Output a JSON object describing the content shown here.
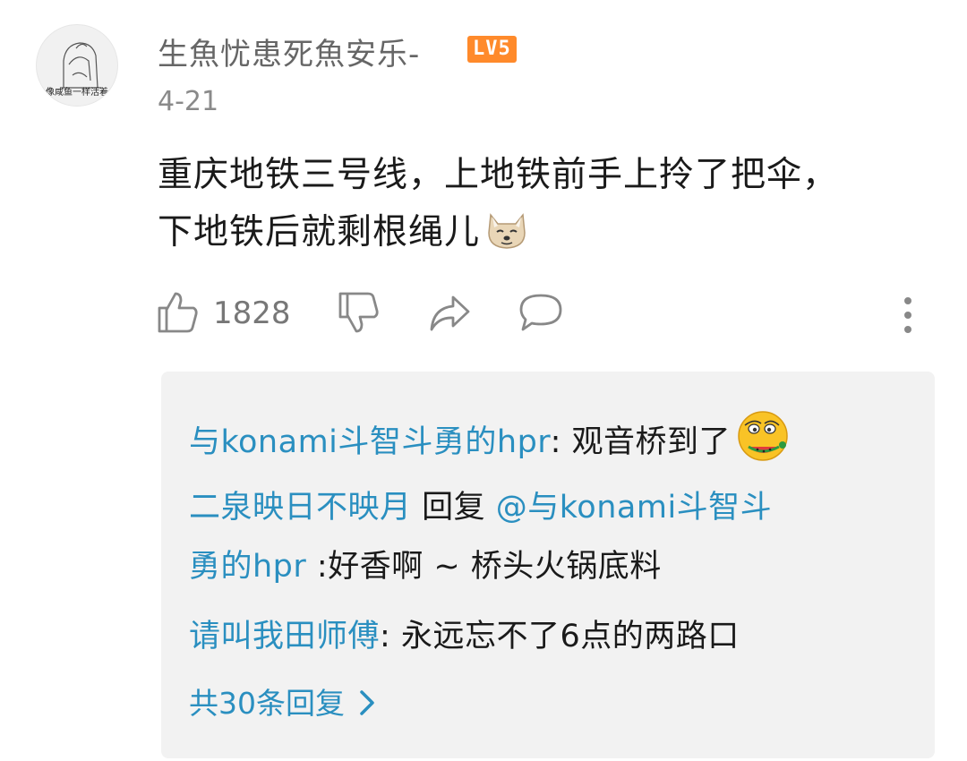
{
  "comment": {
    "avatar_caption": "像咸鱼一样活着",
    "username": "生魚忧患死魚安乐-",
    "level": "LV5",
    "date": "4-21",
    "text_line1": "重庆地铁三号线，上地铁前手上拎了把伞，",
    "text_line2": "下地铁后就剩根绳儿",
    "emoji": "doge-emoji",
    "like_count": "1828"
  },
  "actions": {
    "icons": [
      "thumbs-up-icon",
      "thumbs-down-icon",
      "share-icon",
      "comment-icon",
      "more-vertical-icon"
    ]
  },
  "replies": {
    "items": [
      {
        "user": "与konami斗智斗勇的hpr",
        "sep": ": ",
        "text": "观音桥到了",
        "emoji": "watermelon-face-emoji"
      },
      {
        "user": "二泉映日不映月",
        "reply_word": " 回复 ",
        "mention_line1": "@与konami斗智斗",
        "mention_line2": "勇的hpr",
        "text": " :好香啊 ~ 桥头火锅底料"
      },
      {
        "user": "请叫我田师傅",
        "sep": ": ",
        "text": "永远忘不了6点的两路口"
      }
    ],
    "more_label": "共30条回复"
  },
  "colors": {
    "link": "#2a8fc0",
    "badge": "#ff8a2b",
    "reply_bg": "#f2f2f2",
    "icon": "#888888"
  }
}
